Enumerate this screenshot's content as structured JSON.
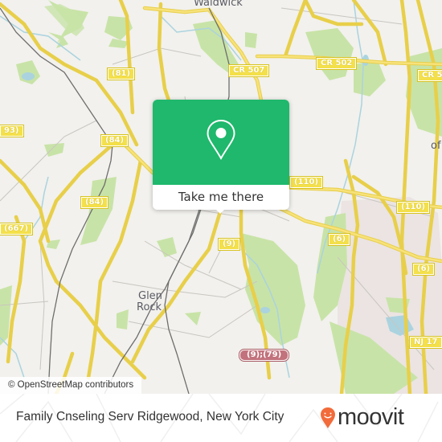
{
  "map": {
    "place_labels": {
      "waldwick": "Waldwick",
      "glen_rock_line1": "Glen",
      "glen_rock_line2": "Rock",
      "partial_of": "of"
    },
    "road_shields": {
      "cr507": "CR 507",
      "cr502": "CR 502",
      "cr5_partial": "CR 5",
      "r81": "(81)",
      "r84_top": "(84)",
      "r84_mid": "(84)",
      "r93": "93)",
      "r667": "(667)",
      "r110_left": "(110)",
      "r110_right": "(110)",
      "r9": "(9)",
      "r6_left": "(6)",
      "r6_right": "(6)",
      "nj17": "NJ 17",
      "us9_79": "(9);(79)"
    },
    "attribution": "© OpenStreetMap contributors",
    "colors": {
      "land": "#f2f1ed",
      "park": "#c8e3a7",
      "water": "#aad3df",
      "road_major": "#f6df6a",
      "road_minor": "#c9c6c0",
      "rail": "#6e6e6e",
      "industrial": "#ebe3e3"
    }
  },
  "popup": {
    "button_label": "Take me there",
    "pin_icon": "map-pin-icon",
    "accent": "#1fb86c"
  },
  "footer": {
    "title": "Family Cnseling Serv Ridgewood, New York City",
    "brand": "moovit",
    "brand_color": "#f26b3a"
  }
}
